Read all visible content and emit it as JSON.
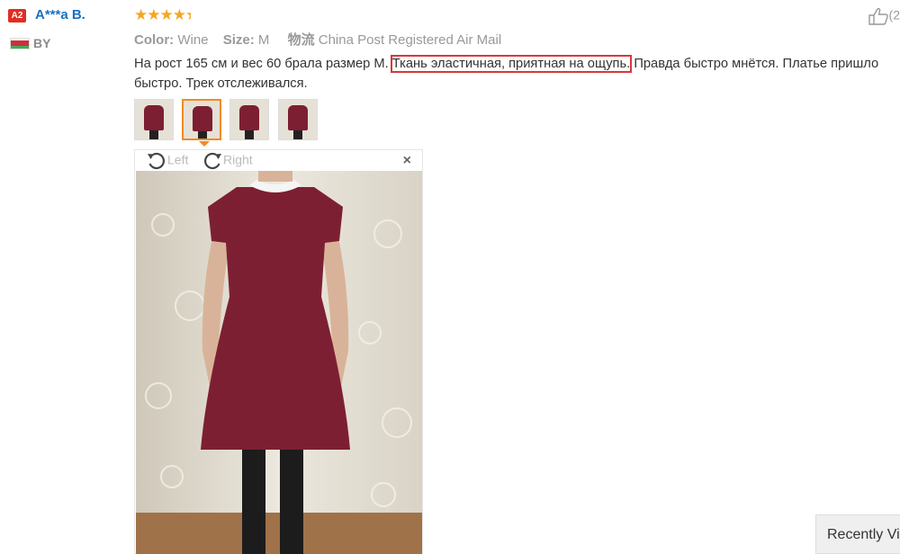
{
  "reviewer": {
    "level": "A2",
    "name": "A***a B.",
    "country": "BY"
  },
  "rating": {
    "stars": 4.5,
    "glyph_full": "★★★★★"
  },
  "helpful": {
    "count_text": "(2"
  },
  "meta": {
    "color_label": "Color:",
    "color_value": "Wine",
    "size_label": "Size:",
    "size_value": "M",
    "shipping_label": "物流",
    "shipping_value": "China Post Registered Air Mail"
  },
  "review": {
    "before": "На рост 165 см и вес 60 брала размер М. ",
    "highlight": "Ткань эластичная, приятная на ощупь.",
    "after": " Правда быстро мнётся. Платье пришло быстро. Трек отслеживался."
  },
  "thumbnails": {
    "count": 4,
    "active_index": 1
  },
  "viewer": {
    "rotate_left": "Left",
    "rotate_right": "Right",
    "close": "×"
  },
  "recently_viewed": {
    "label": "Recently Vi"
  },
  "colors": {
    "accent_orange": "#f08a24",
    "link_blue": "#1a6fc2",
    "star": "#f5a623",
    "highlight_box": "#d9383a",
    "dress": "#7d1f32"
  }
}
